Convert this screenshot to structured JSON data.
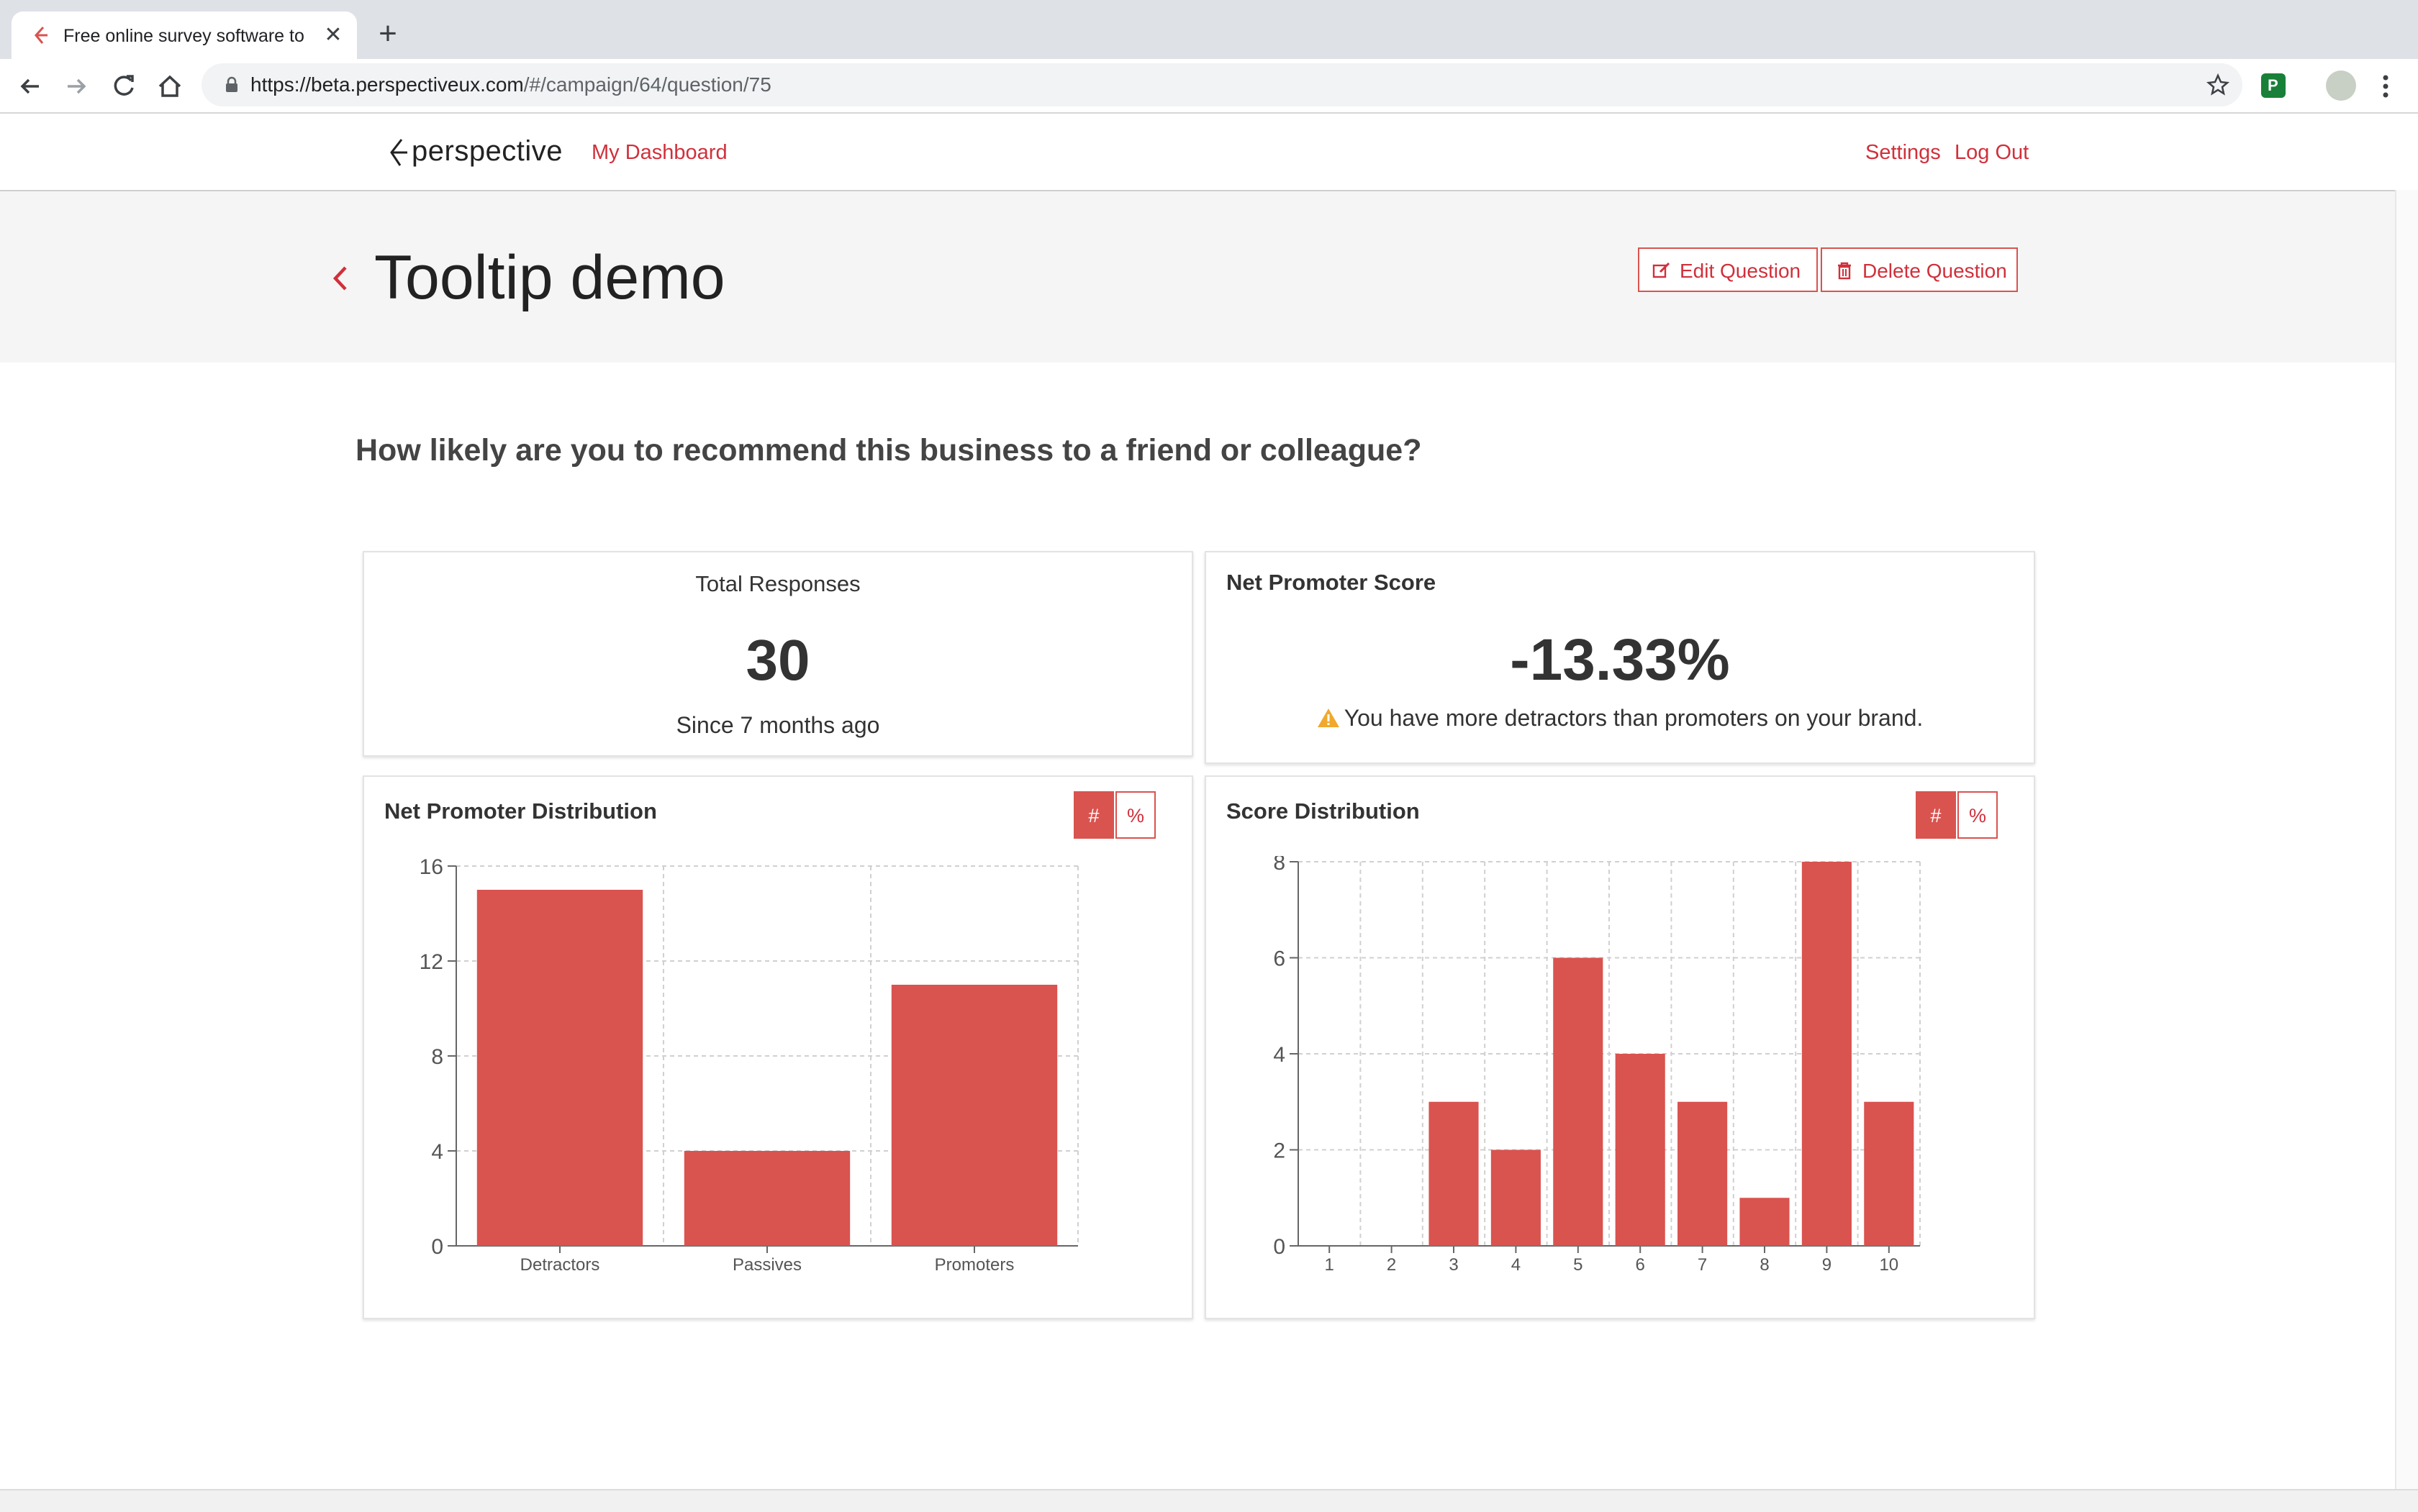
{
  "browser": {
    "tab_title": "Free online survey software to",
    "url_host": "https://beta.perspectiveux.com",
    "url_path": "/#/campaign/64/question/75",
    "extension_label": "P"
  },
  "app": {
    "logo_text": "perspective",
    "nav": {
      "dashboard": "My Dashboard",
      "settings": "Settings",
      "logout": "Log Out"
    },
    "accent_color": "#d9534f"
  },
  "page": {
    "title": "Tooltip demo",
    "edit_label": "Edit Question",
    "delete_label": "Delete Question",
    "question": "How likely are you to recommend this business to a friend or colleague?"
  },
  "total_responses": {
    "label": "Total Responses",
    "value": "30",
    "since": "Since 7 months ago"
  },
  "nps": {
    "title": "Net Promoter Score",
    "value": "-13.33%",
    "warning": "You have more detractors than promoters on your brand."
  },
  "toggle": {
    "count": "#",
    "percent": "%"
  },
  "npd_card": {
    "title": "Net Promoter Distribution"
  },
  "score_card": {
    "title": "Score Distribution"
  },
  "chart_data": [
    {
      "type": "bar",
      "title": "Net Promoter Distribution",
      "categories": [
        "Detractors",
        "Passives",
        "Promoters"
      ],
      "values": [
        15,
        4,
        11
      ],
      "yticks": [
        0,
        4,
        8,
        12,
        16
      ],
      "ylim": [
        0,
        16
      ],
      "grid": true,
      "color": "#d9534f"
    },
    {
      "type": "bar",
      "title": "Score Distribution",
      "categories": [
        "1",
        "2",
        "3",
        "4",
        "5",
        "6",
        "7",
        "8",
        "9",
        "10"
      ],
      "values": [
        0,
        0,
        3,
        2,
        6,
        4,
        3,
        1,
        8,
        3
      ],
      "yticks": [
        0,
        2,
        4,
        6,
        8
      ],
      "ylim": [
        0,
        8
      ],
      "grid": true,
      "color": "#d9534f"
    }
  ]
}
